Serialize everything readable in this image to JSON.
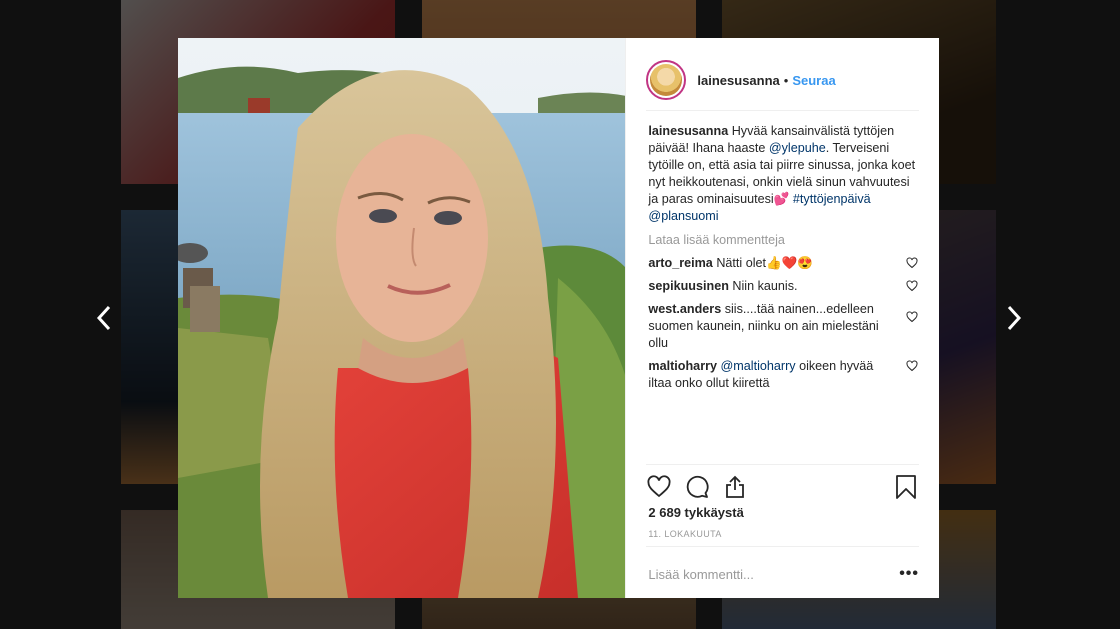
{
  "post": {
    "username": "lainesusanna",
    "separator": "•",
    "follow_label": "Seuraa",
    "caption": {
      "username": "lainesusanna",
      "text_1": "Hyvää kansainvälistä tyttöjen päivää! Ihana haaste",
      "mention_1": "@ylepuhe",
      "text_2": ". Terveiseni tytöille on, että asia tai piirre sinussa, jonka koet nyt heikkoutenasi, onkin vielä sinun vahvuutesi ja paras ominaisuutesi💕",
      "hashtag": "#tyttöjenpäivä",
      "mention_2": "@plansuomi"
    },
    "load_more": "Lataa lisää kommentteja",
    "comments": [
      {
        "username": "arto_reima",
        "text": "Nätti olet👍❤️😍"
      },
      {
        "username": "sepikuusinen",
        "text": "Niin kaunis."
      },
      {
        "username": "west.anders",
        "text": "siis....tää nainen...edelleen suomen kaunein, niinku on ain mielestäni ollu"
      },
      {
        "username": "maltioharry",
        "mention": "@maltioharry",
        "text": "oikeen hyvää iltaa onko ollut kiirettä"
      }
    ],
    "likes": "2 689 tykkäystä",
    "date": "11. LOKAKUUTA",
    "comment_placeholder": "Lisää kommentti...",
    "more_label": "•••"
  },
  "icons": {
    "like": "heart-icon",
    "comment": "comment-icon",
    "share": "share-icon",
    "save": "bookmark-icon",
    "prev": "chevron-left-icon",
    "next": "chevron-right-icon"
  },
  "colors": {
    "link": "#3897f0",
    "mention": "#003569",
    "text": "#262626",
    "muted": "#999999"
  }
}
